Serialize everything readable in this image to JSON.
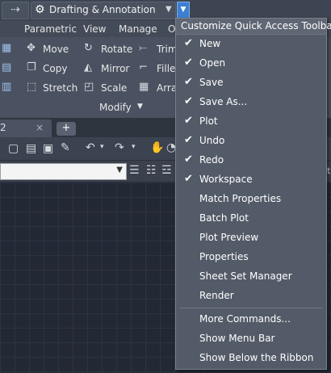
{
  "titlebar": {
    "workspace": "Drafting & Annotation",
    "left_arrow_icon": "redo-arrow-icon"
  },
  "ribbon": {
    "tabs": [
      "Parametric",
      "View",
      "Manage",
      "O"
    ],
    "commands": {
      "move": "Move",
      "rotate": "Rotate",
      "trim": "Trim",
      "copy": "Copy",
      "mirror": "Mirror",
      "fillet": "Fillet",
      "stretch": "Stretch",
      "scale": "Scale",
      "array": "Array"
    },
    "panel_label": "Modify"
  },
  "doc_tabs": {
    "first_tab": "2",
    "close": "×",
    "add": "+"
  },
  "toolbar": {
    "right_label": "St"
  },
  "menu": {
    "title": "Customize Quick Access Toolbar",
    "checked_items": [
      "New",
      "Open",
      "Save",
      "Save As...",
      "Plot",
      "Undo",
      "Redo",
      "Workspace"
    ],
    "unchecked_items": [
      "Match Properties",
      "Batch Plot",
      "Plot Preview",
      "Properties",
      "Sheet Set Manager",
      "Render"
    ],
    "extra_items": [
      "More Commands...",
      "Show Menu Bar",
      "Show Below the Ribbon"
    ]
  },
  "colors": {
    "accent": "#3d7fd1",
    "menu_bg": "#535b68",
    "canvas": "#222834"
  }
}
